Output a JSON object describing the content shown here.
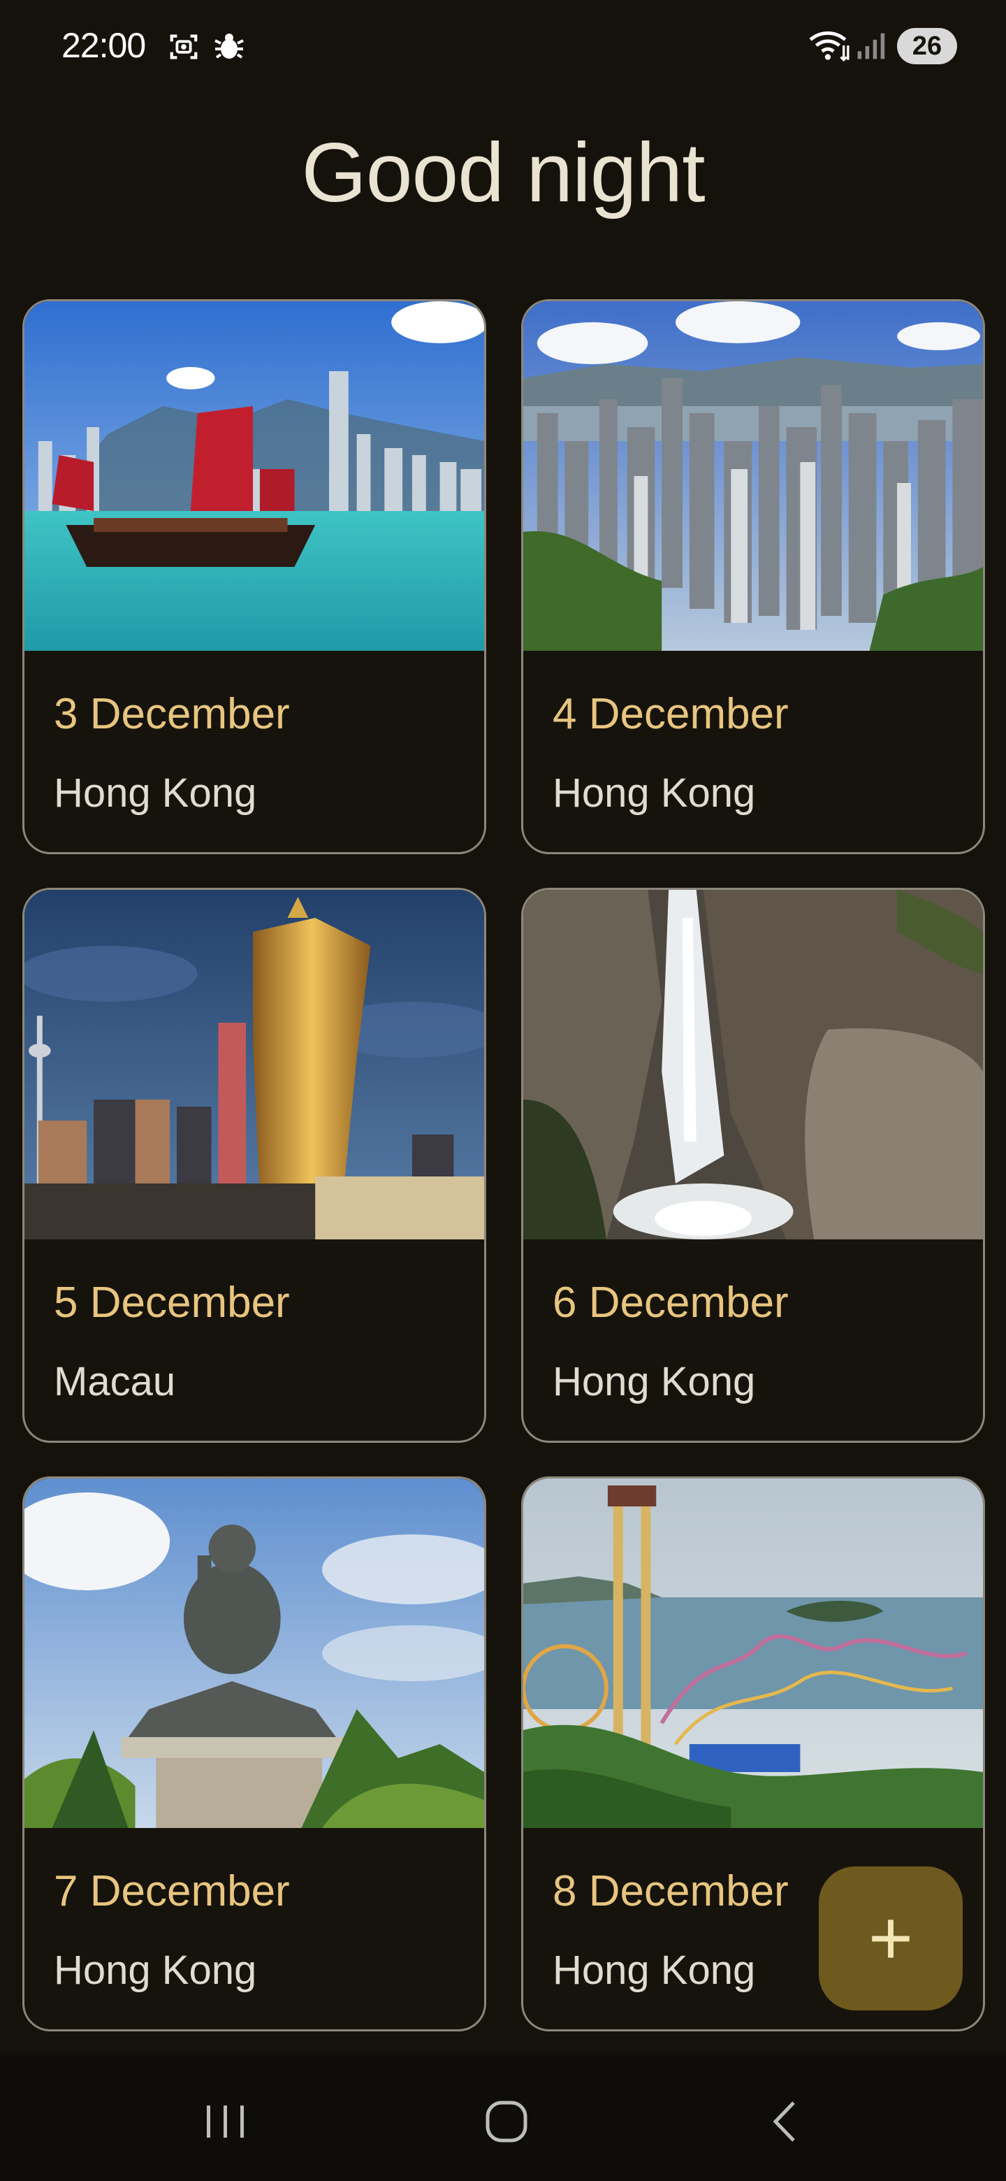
{
  "status_bar": {
    "time": "22:00",
    "battery": "26",
    "icons": [
      "screenshot-icon",
      "bug-icon",
      "wifi-icon",
      "signal-icon"
    ]
  },
  "title": "Good night",
  "cards": [
    {
      "date": "3 December",
      "place": "Hong Kong",
      "image": "junk-boat-harbour"
    },
    {
      "date": "4 December",
      "place": "Hong Kong",
      "image": "city-skyline-peak"
    },
    {
      "date": "5 December",
      "place": "Macau",
      "image": "casino-tower-skyline"
    },
    {
      "date": "6 December",
      "place": "Hong Kong",
      "image": "waterfall-rocks"
    },
    {
      "date": "7 December",
      "place": "Hong Kong",
      "image": "big-buddha"
    },
    {
      "date": "8 December",
      "place": "Hong Kong",
      "image": "theme-park-coast"
    }
  ],
  "fab": {
    "label": "+",
    "icon": "add-icon"
  },
  "nav_bar": {
    "icons": [
      "recent-apps-icon",
      "home-icon",
      "back-icon"
    ]
  },
  "colors": {
    "background": "#15120c",
    "accent_date": "#e8c57f",
    "fab": "#6e5a1e",
    "card_border": "#8c877c"
  }
}
